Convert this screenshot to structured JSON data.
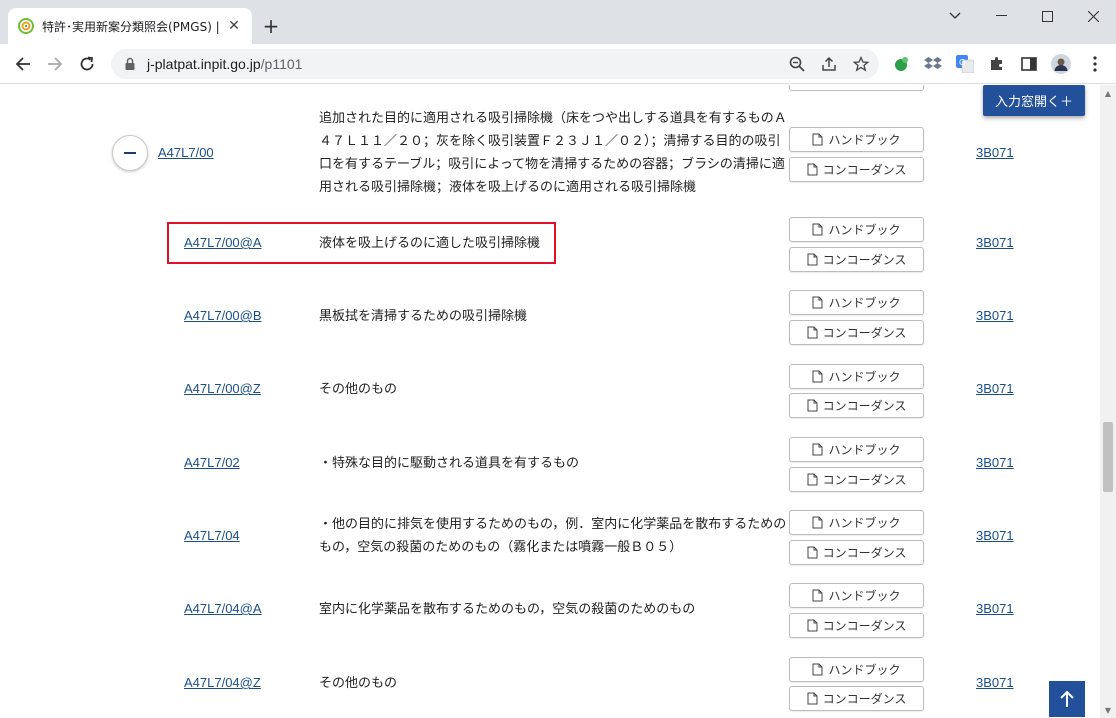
{
  "browser": {
    "tab_title": "特許･実用新案分類照会(PMGS) | ",
    "url_host": "j-platpat.inpit.go.jp",
    "url_path": "/p1101"
  },
  "page": {
    "input_open_label": "入力窓開く＋",
    "handbook_label": "ハンドブック",
    "concordance_label": "コンコーダンス",
    "rows": [
      {
        "code": "A47L7/00",
        "desc": "追加された目的に適用される吸引掃除機（床をつや出しする道具を有するものＡ４７Ｌ１１／２０；灰を除く吸引装置Ｆ２３Ｊ１／０２）；清掃する目的の吸引口を有するテーブル；吸引によって物を清掃するための容器；ブラシの清掃に適用される吸引掃除機；液体を吸上げるのに適用される吸引掃除機",
        "ref": "3B071"
      },
      {
        "code": "A47L7/00@A",
        "desc": "液体を吸上げるのに適した吸引掃除機",
        "ref": "3B071"
      },
      {
        "code": "A47L7/00@B",
        "desc": "黒板拭を清掃するための吸引掃除機",
        "ref": "3B071"
      },
      {
        "code": "A47L7/00@Z",
        "desc": "その他のもの",
        "ref": "3B071"
      },
      {
        "code": "A47L7/02",
        "desc": "・特殊な目的に駆動される道具を有するもの",
        "ref": "3B071"
      },
      {
        "code": "A47L7/04",
        "desc": "・他の目的に排気を使用するためのもの，例．室内に化学薬品を散布するためのもの，空気の殺菌のためのもの（霧化または噴霧一般Ｂ０５）",
        "ref": "3B071"
      },
      {
        "code": "A47L7/04@A",
        "desc": "室内に化学薬品を散布するためのもの，空気の殺菌のためのもの",
        "ref": "3B071"
      },
      {
        "code": "A47L7/04@Z",
        "desc": "その他のもの",
        "ref": "3B071"
      }
    ]
  },
  "colors": {
    "link": "#1a4f8b",
    "accent_button": "#23509a",
    "highlight": "#e0102a"
  }
}
